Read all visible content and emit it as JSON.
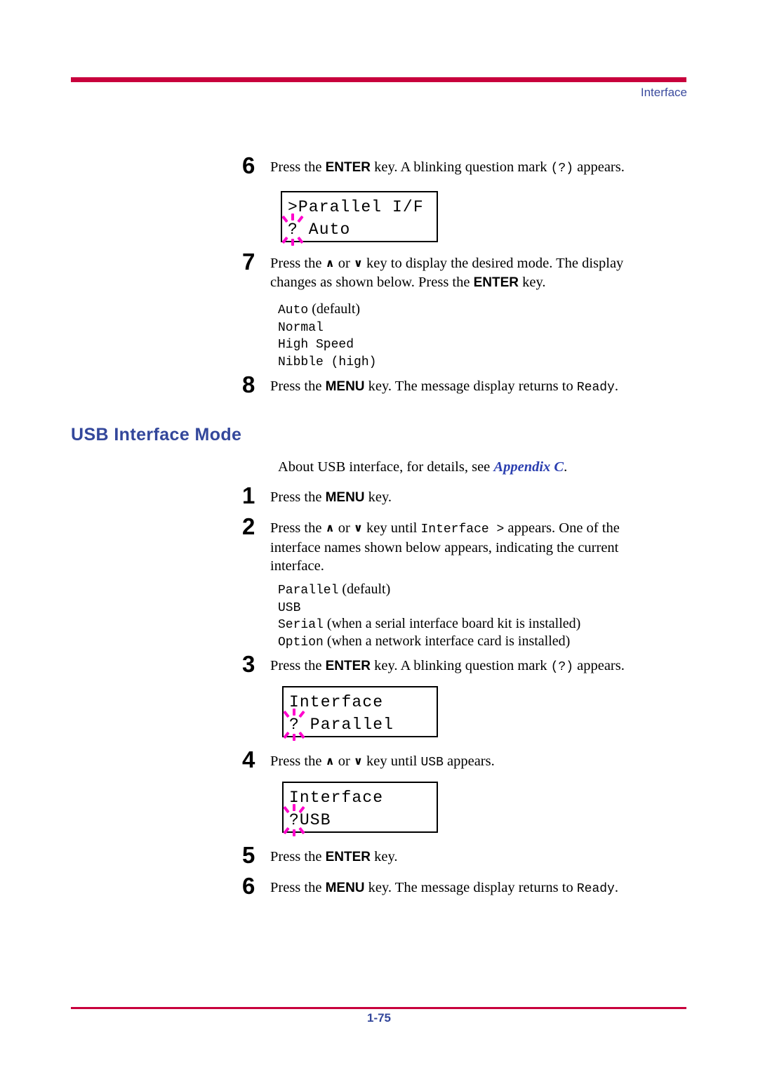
{
  "header": {
    "chapter_label": "Interface",
    "rule_color": "#c8003c",
    "label_color": "#3b4b9e"
  },
  "footer": {
    "page_number": "1-75",
    "rule_color": "#c8003c",
    "page_number_color": "#33479b"
  },
  "parallel_section": {
    "step6": {
      "number": "6",
      "text_before_bold": "Press the ",
      "bold": "ENTER",
      "text_after_bold": " key. A blinking question mark ",
      "mono_inline": "(?)",
      "text_end": " appears."
    },
    "lcd1": {
      "line1": ">Parallel I/F",
      "line2_marker": "?",
      "line2_text": " Auto"
    },
    "step7": {
      "number": "7",
      "text1": "Press the ",
      "up_arrow": "∧",
      "text2": " or ",
      "down_arrow": "∨",
      "text3": " key to display the desired mode. The display changes as shown below. Press the ",
      "bold": "ENTER",
      "text4": " key."
    },
    "modes": [
      {
        "value": "Auto",
        "note": " (default)"
      },
      {
        "value": "Normal",
        "note": ""
      },
      {
        "value": "High Speed",
        "note": ""
      },
      {
        "value": "Nibble (high)",
        "note": ""
      }
    ],
    "step8": {
      "number": "8",
      "text1": "Press the ",
      "bold": "MENU",
      "text2": " key. The message display returns to ",
      "mono_end": "Ready",
      "text3": "."
    }
  },
  "usb_section": {
    "heading": "USB Interface Mode",
    "intro": {
      "text_before": "About USB interface, for details, see ",
      "link": "Appendix C",
      "text_after": "."
    },
    "step1": {
      "number": "1",
      "text1": "Press the ",
      "bold": "MENU",
      "text2": " key."
    },
    "step2": {
      "number": "2",
      "text1": "Press the ",
      "up_arrow": "∧",
      "text2": " or ",
      "down_arrow": "∨",
      "text3": " key until ",
      "mono": "Interface >",
      "text4": " appears. One of the interface names shown below appears, indicating the current interface."
    },
    "interfaces": [
      {
        "value": "Parallel",
        "note": " (default)"
      },
      {
        "value": "USB",
        "note": ""
      },
      {
        "value": "Serial",
        "note": " (when a serial interface board kit is installed)"
      },
      {
        "value": "Option",
        "note": " (when a network interface card is installed)"
      }
    ],
    "step3": {
      "number": "3",
      "text_before_bold": "Press the ",
      "bold": "ENTER",
      "text_after_bold": " key. A blinking question mark ",
      "mono_inline": "(?)",
      "text_end": " appears."
    },
    "lcd2": {
      "line1": "Interface",
      "line2_marker": "?",
      "line2_text": " Parallel"
    },
    "step4": {
      "number": "4",
      "text1": "Press the ",
      "up_arrow": "∧",
      "text2": " or ",
      "down_arrow": "∨",
      "text3": " key until ",
      "mono": "USB",
      "text4": " appears."
    },
    "lcd3": {
      "line1": "Interface",
      "line2_marker": "?",
      "line2_text": "USB"
    },
    "step5": {
      "number": "5",
      "text1": "Press the ",
      "bold": "ENTER",
      "text2": " key."
    },
    "step6": {
      "number": "6",
      "text1": "Press the ",
      "bold": "MENU",
      "text2": " key. The message display returns to ",
      "mono_end": "Ready",
      "text3": "."
    }
  },
  "blink_indicator": {
    "icon": "blinking-starburst",
    "color": "#ff00cc"
  }
}
